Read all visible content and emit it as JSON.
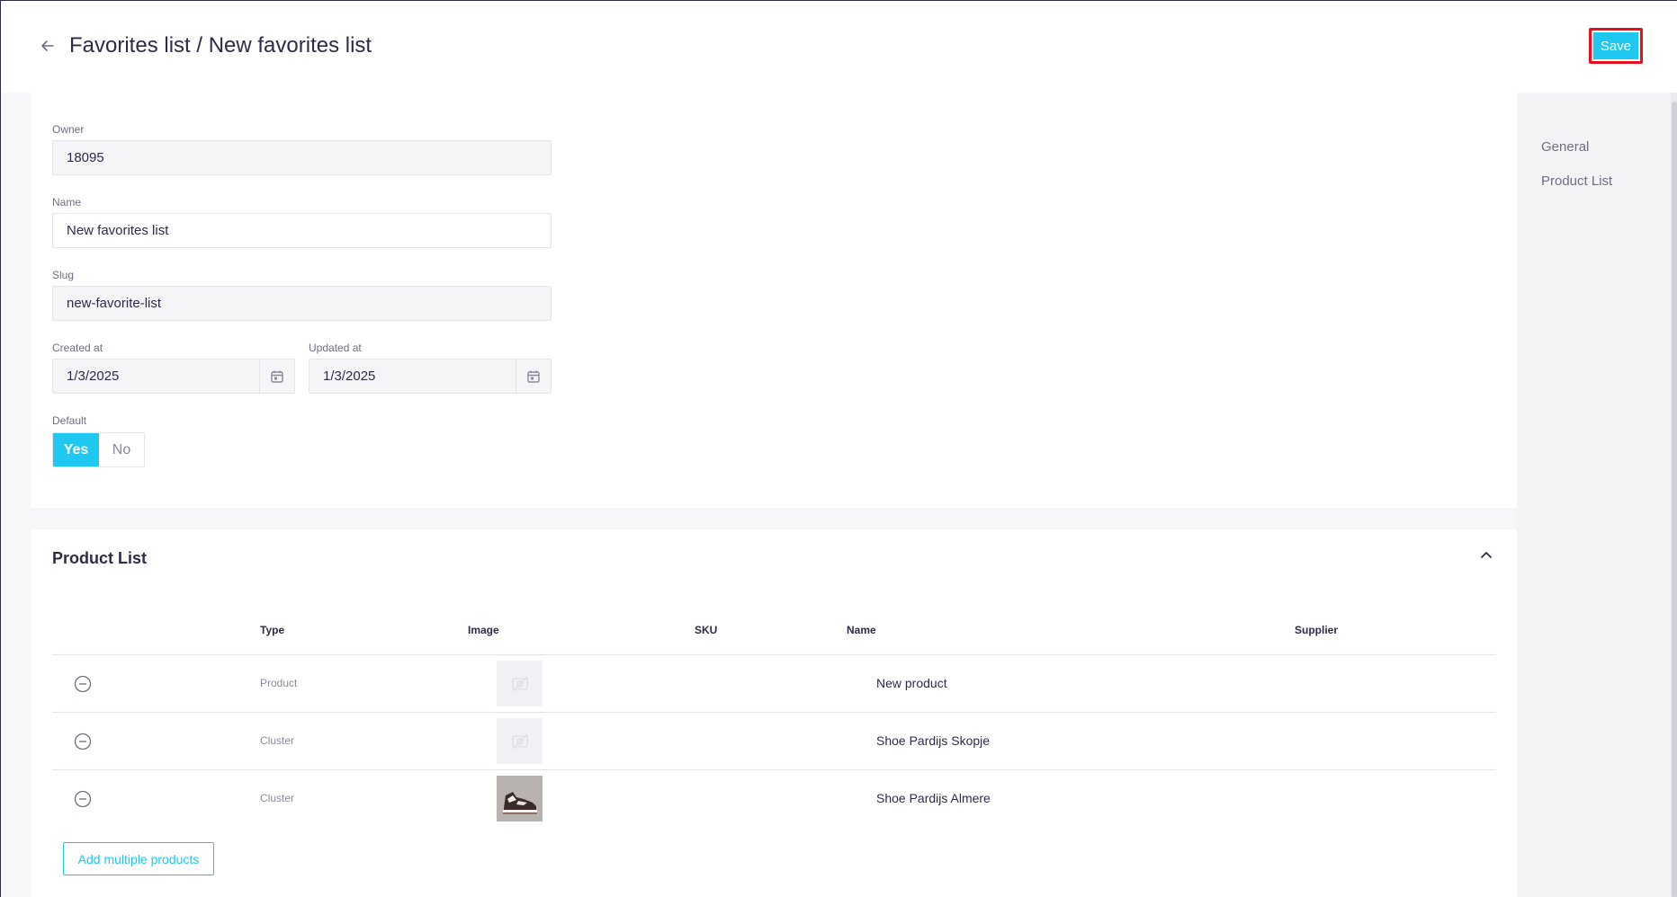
{
  "header": {
    "title": "Favorites list / New favorites list",
    "save_label": "Save"
  },
  "right_nav": {
    "items": [
      {
        "label": "General"
      },
      {
        "label": "Product List"
      }
    ]
  },
  "general": {
    "owner": {
      "label": "Owner",
      "value": "18095"
    },
    "name": {
      "label": "Name",
      "value": "New favorites list"
    },
    "slug": {
      "label": "Slug",
      "value": "new-favorite-list"
    },
    "created_at": {
      "label": "Created at",
      "value": "1/3/2025"
    },
    "updated_at": {
      "label": "Updated at",
      "value": "1/3/2025"
    },
    "default": {
      "label": "Default",
      "yes": "Yes",
      "no": "No",
      "selected": "Yes"
    }
  },
  "product_list": {
    "title": "Product List",
    "columns": [
      "Type",
      "Image",
      "SKU",
      "Name",
      "Supplier"
    ],
    "rows": [
      {
        "type": "Product",
        "image": "placeholder-image-icon",
        "sku": "",
        "name": "New product",
        "supplier": ""
      },
      {
        "type": "Cluster",
        "image": "placeholder-image-icon",
        "sku": "",
        "name": "Shoe Pardijs Skopje",
        "supplier": ""
      },
      {
        "type": "Cluster",
        "image": "sneaker-photo",
        "sku": "",
        "name": "Shoe Pardijs Almere",
        "supplier": ""
      }
    ],
    "add_button_label": "Add multiple products"
  },
  "colors": {
    "accent": "#1ec8f0",
    "highlight_outline": "#e8101c",
    "text": "#2d2a4a"
  }
}
